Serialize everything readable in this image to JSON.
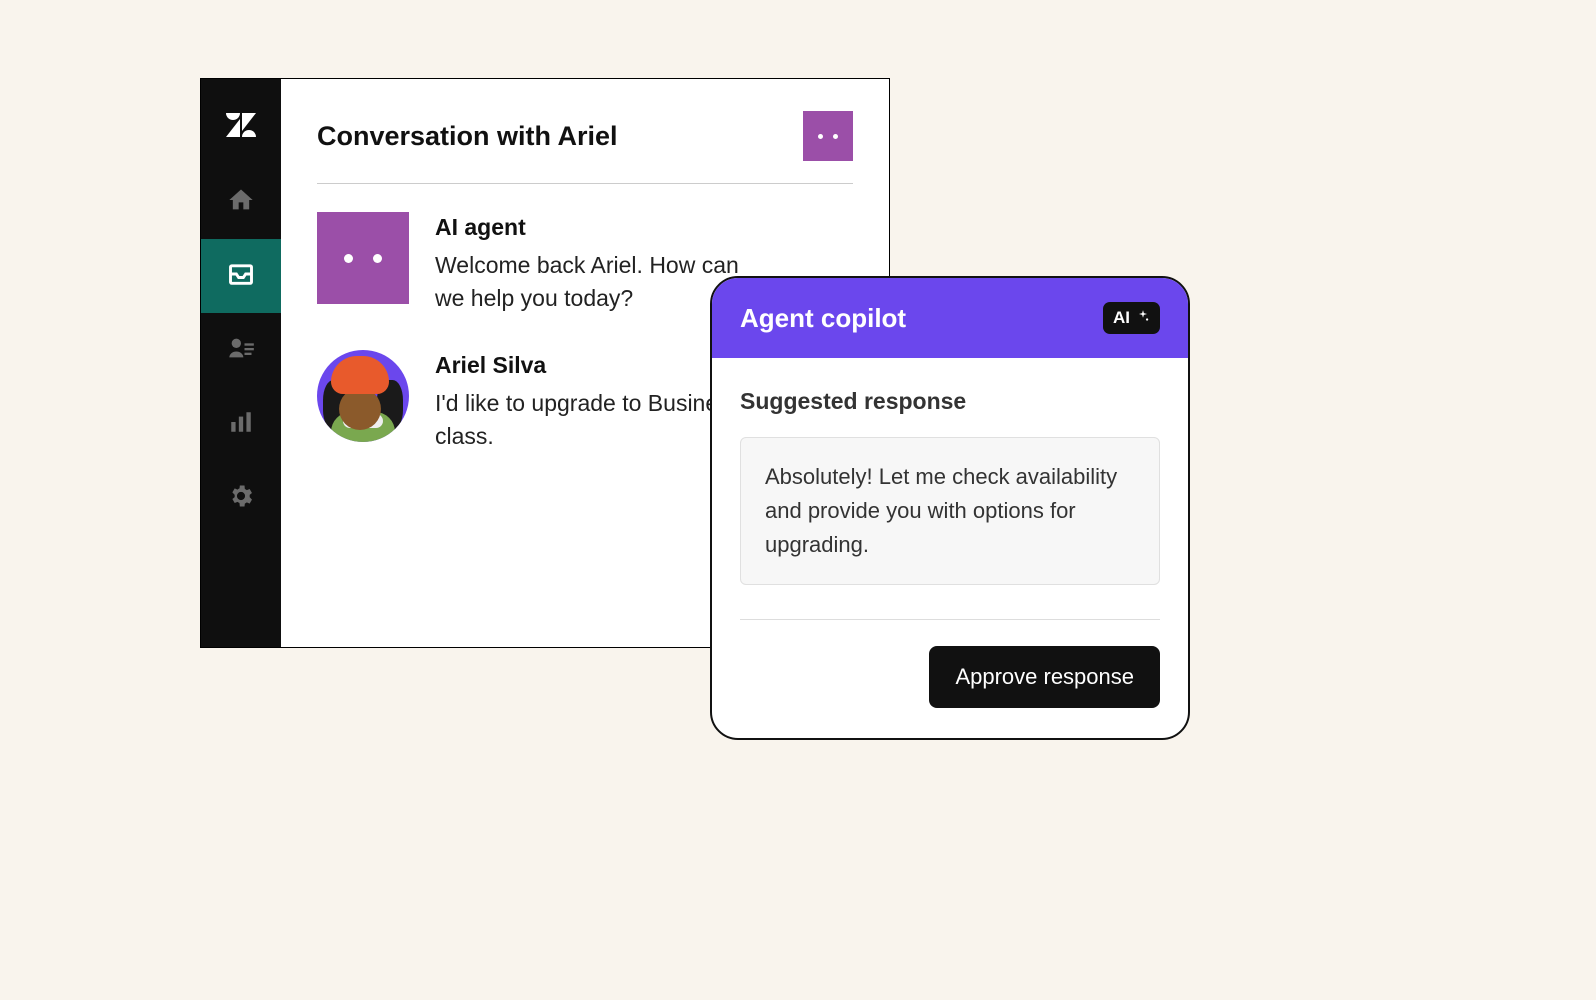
{
  "conversation": {
    "title": "Conversation with Ariel",
    "messages": [
      {
        "sender": "AI agent",
        "text": "Welcome back Ariel. How can we help you today?"
      },
      {
        "sender": "Ariel Silva",
        "text": "I'd like to upgrade to Business class."
      }
    ]
  },
  "sidebar": {
    "items": [
      {
        "name": "logo",
        "icon": "zendesk-logo-icon"
      },
      {
        "name": "home",
        "icon": "home-icon"
      },
      {
        "name": "tickets",
        "icon": "inbox-icon",
        "active": true
      },
      {
        "name": "customers",
        "icon": "customers-icon"
      },
      {
        "name": "reports",
        "icon": "bar-chart-icon"
      },
      {
        "name": "settings",
        "icon": "gear-icon"
      }
    ]
  },
  "copilot": {
    "title": "Agent copilot",
    "ai_badge": "AI",
    "suggested_label": "Suggested response",
    "suggestion": "Absolutely! Let me check availability and provide you with options for upgrading.",
    "approve_label": "Approve response"
  }
}
